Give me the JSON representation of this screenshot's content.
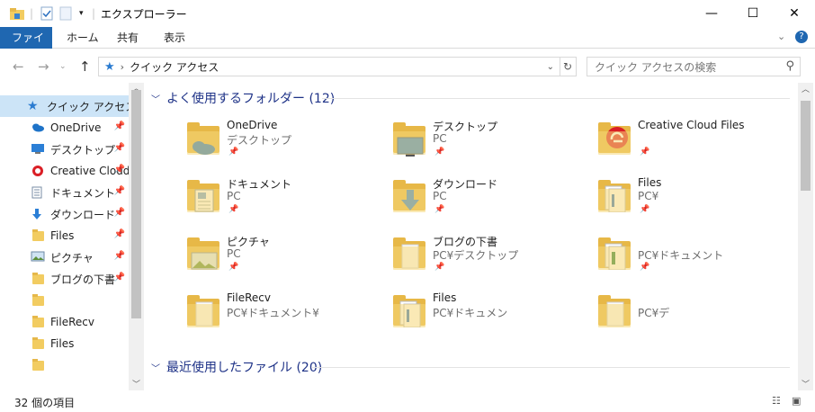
{
  "window": {
    "title": "エクスプローラー",
    "minimize": "—",
    "maximize": "☐",
    "close": "✕"
  },
  "ribbon": {
    "tabs": [
      "ファイル",
      "ホーム",
      "共有",
      "表示"
    ],
    "help": "?"
  },
  "address": {
    "path": "クイック アクセス",
    "search_placeholder": "クイック アクセスの検索"
  },
  "nav": {
    "items": [
      {
        "label": "クイック アクセス",
        "icon": "star-icon",
        "pinned": false
      },
      {
        "label": "OneDrive",
        "icon": "onedrive-icon",
        "pinned": true
      },
      {
        "label": "デスクトップ",
        "icon": "desktop-icon",
        "pinned": true
      },
      {
        "label": "Creative Cloud Files",
        "icon": "creative-cloud-icon",
        "pinned": true
      },
      {
        "label": "ドキュメント",
        "icon": "documents-icon",
        "pinned": true
      },
      {
        "label": "ダウンロード",
        "icon": "download-icon",
        "pinned": true
      },
      {
        "label": "Files",
        "icon": "folder-icon",
        "pinned": true
      },
      {
        "label": "ピクチャ",
        "icon": "pictures-icon",
        "pinned": true
      },
      {
        "label": "ブログの下書",
        "icon": "folder-icon",
        "pinned": true
      },
      {
        "label": "",
        "icon": "folder-icon",
        "pinned": false
      },
      {
        "label": "FileRecv",
        "icon": "folder-icon",
        "pinned": false
      },
      {
        "label": "Files",
        "icon": "folder-icon",
        "pinned": false
      },
      {
        "label": "",
        "icon": "folder-icon",
        "pinned": false
      }
    ]
  },
  "groups": {
    "frequent": "よく使用するフォルダー (12)",
    "recent": "最近使用したファイル (20)"
  },
  "tiles": [
    {
      "name": "OneDrive",
      "sub": "デスクトップ",
      "kind": "onedrive",
      "pinned": true
    },
    {
      "name": "デスクトップ",
      "sub": "PC",
      "kind": "desktop",
      "pinned": true
    },
    {
      "name": "Creative Cloud Files",
      "sub": "",
      "kind": "creative",
      "pinned": true
    },
    {
      "name": "ドキュメント",
      "sub": "PC",
      "kind": "documents",
      "pinned": true
    },
    {
      "name": "ダウンロード",
      "sub": "PC",
      "kind": "download",
      "pinned": true
    },
    {
      "name": "Files",
      "sub": "PC¥",
      "kind": "docs-folder",
      "pinned": true
    },
    {
      "name": "ピクチャ",
      "sub": "PC",
      "kind": "pictures",
      "pinned": true
    },
    {
      "name": "ブログの下書",
      "sub": "PC¥デスクトップ",
      "kind": "folder",
      "pinned": true
    },
    {
      "name": "",
      "sub": "PC¥ドキュメント",
      "kind": "excel-folder",
      "pinned": true
    },
    {
      "name": "FileRecv",
      "sub": "PC¥ドキュメント¥",
      "kind": "folder",
      "pinned": false
    },
    {
      "name": "Files",
      "sub": "PC¥ドキュメン",
      "kind": "docs-folder",
      "pinned": false
    },
    {
      "name": "",
      "sub": "PC¥デ",
      "kind": "folder",
      "pinned": false
    }
  ],
  "status": {
    "count": "32 個の項目"
  }
}
